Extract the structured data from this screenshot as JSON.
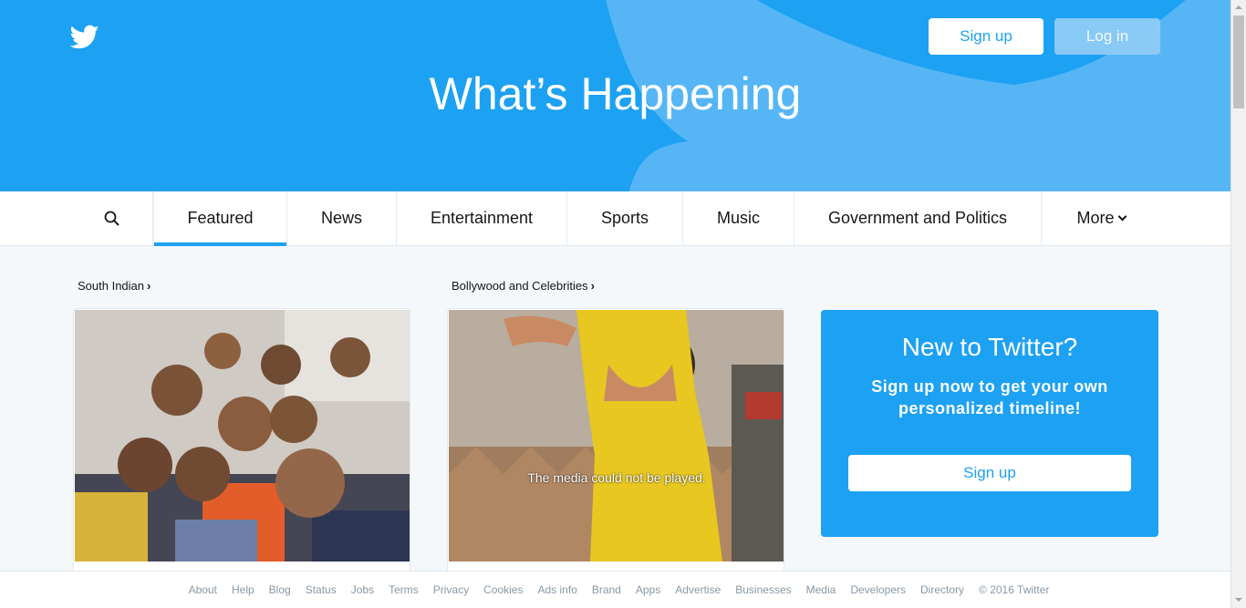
{
  "header": {
    "title": "What’s Happening",
    "signup_label": "Sign up",
    "login_label": "Log in",
    "logo_icon": "twitter-bird-icon"
  },
  "nav": {
    "search_icon": "search-icon",
    "items": [
      {
        "label": "Featured",
        "active": true
      },
      {
        "label": "News"
      },
      {
        "label": "Entertainment"
      },
      {
        "label": "Sports"
      },
      {
        "label": "Music"
      },
      {
        "label": "Government and Politics"
      },
      {
        "label": "More"
      }
    ]
  },
  "sections": [
    {
      "label": "South Indian",
      "arrow": "›"
    },
    {
      "label": "Bollywood and Celebrities",
      "arrow": "›",
      "media_message": "The media could not be played."
    }
  ],
  "promo": {
    "title": "New to Twitter?",
    "subtitle": "Sign up now to get your own personalized timeline!",
    "button": "Sign up"
  },
  "footer": {
    "links": [
      "About",
      "Help",
      "Blog",
      "Status",
      "Jobs",
      "Terms",
      "Privacy",
      "Cookies",
      "Ads info",
      "Brand",
      "Apps",
      "Advertise",
      "Businesses",
      "Media",
      "Developers",
      "Directory"
    ],
    "copyright": "© 2016 Twitter"
  },
  "colors": {
    "brand": "#1da1f2",
    "background": "#f5f8fa",
    "footer_text": "#8899a6"
  }
}
